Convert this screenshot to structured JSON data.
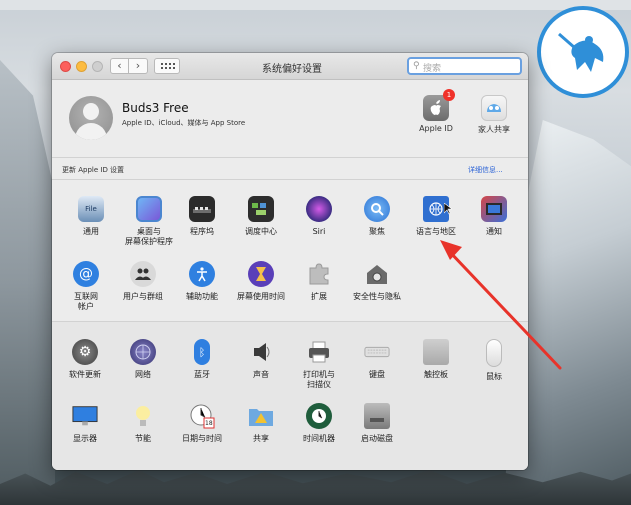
{
  "window": {
    "title": "系统偏好设置",
    "search_placeholder": "搜索",
    "nav_back": "‹",
    "nav_forward": "›"
  },
  "account": {
    "name": "Buds3 Free",
    "subtitle": "Apple ID、iCloud、媒体与 App Store",
    "update_notice": "更新 Apple ID 设置",
    "details_link": "详细信息...",
    "apple_id_label": "Apple ID",
    "apple_id_badge": "1",
    "family_label": "家人共享"
  },
  "prefs_row1": [
    {
      "label": "通用",
      "icon": "general-icon"
    },
    {
      "label": "桌面与\n屏幕保护程序",
      "icon": "desktop-icon"
    },
    {
      "label": "程序坞",
      "icon": "dock-icon"
    },
    {
      "label": "调度中心",
      "icon": "mission-control-icon"
    },
    {
      "label": "Siri",
      "icon": "siri-icon"
    },
    {
      "label": "聚焦",
      "icon": "spotlight-icon"
    },
    {
      "label": "语言与地区",
      "icon": "language-region-icon"
    },
    {
      "label": "通知",
      "icon": "notifications-icon"
    }
  ],
  "prefs_row2": [
    {
      "label": "互联网\n帐户",
      "icon": "internet-accounts-icon"
    },
    {
      "label": "用户与群组",
      "icon": "users-groups-icon"
    },
    {
      "label": "辅助功能",
      "icon": "accessibility-icon"
    },
    {
      "label": "屏幕使用时间",
      "icon": "screen-time-icon"
    },
    {
      "label": "扩展",
      "icon": "extensions-icon"
    },
    {
      "label": "安全性与隐私",
      "icon": "security-privacy-icon"
    }
  ],
  "prefs_row3": [
    {
      "label": "软件更新",
      "icon": "software-update-icon"
    },
    {
      "label": "网络",
      "icon": "network-icon"
    },
    {
      "label": "蓝牙",
      "icon": "bluetooth-icon"
    },
    {
      "label": "声音",
      "icon": "sound-icon"
    },
    {
      "label": "打印机与\n扫描仪",
      "icon": "printers-icon"
    },
    {
      "label": "键盘",
      "icon": "keyboard-icon"
    },
    {
      "label": "触控板",
      "icon": "trackpad-icon"
    },
    {
      "label": "鼠标",
      "icon": "mouse-icon"
    }
  ],
  "prefs_row4": [
    {
      "label": "显示器",
      "icon": "displays-icon"
    },
    {
      "label": "节能",
      "icon": "energy-saver-icon"
    },
    {
      "label": "日期与时间",
      "icon": "date-time-icon"
    },
    {
      "label": "共享",
      "icon": "sharing-icon"
    },
    {
      "label": "时间机器",
      "icon": "time-machine-icon"
    },
    {
      "label": "启动磁盘",
      "icon": "startup-disk-icon"
    }
  ],
  "date_icon_day": "18",
  "colors": {
    "accent": "#2a62d6",
    "arrow": "#e8332a",
    "badge": "#f0322a"
  }
}
